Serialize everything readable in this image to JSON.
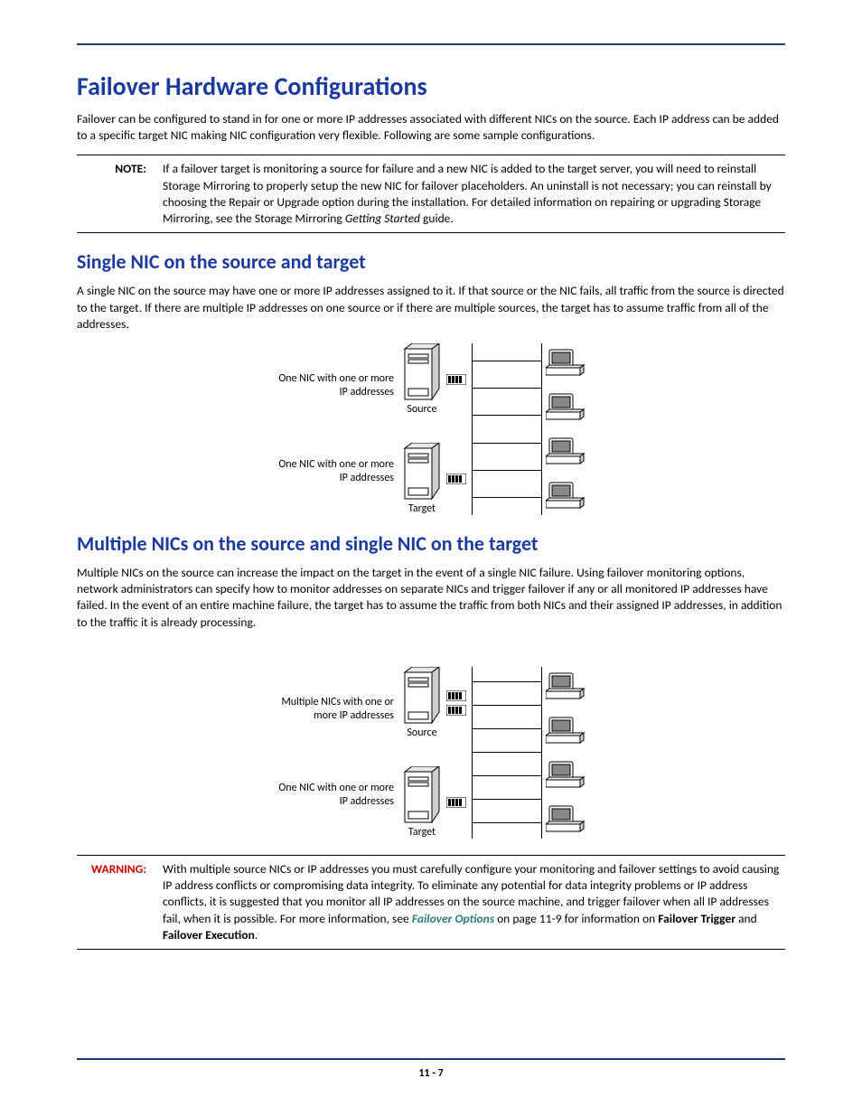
{
  "title": "Failover Hardware Configurations",
  "intro": "Failover can be configured to stand in for one or more IP addresses associated with different NICs on the source. Each IP address can be added to a specific target NIC making NIC configuration very flexible. Following are some sample configurations.",
  "note": {
    "label": "NOTE:",
    "text_a": "If a failover target is monitoring a source for failure and a new NIC is added to the target server, you will need to reinstall Storage Mirroring to properly setup the new NIC for failover placeholders.  An uninstall is not necessary; you can reinstall by choosing the Repair or Upgrade option during the installation. For detailed information on repairing or upgrading Storage Mirroring, see the Storage Mirroring ",
    "ital": "Getting Started",
    "text_b": " guide."
  },
  "section1": {
    "heading": "Single NIC on the source and target",
    "body": "A single NIC on the source may have one or more IP addresses assigned to it. If that source or the NIC fails, all traffic from the source is directed to the target. If there are multiple IP addresses on one source or if there are multiple sources, the target has to assume traffic from all of the addresses.",
    "label_source": "One NIC with one or more IP addresses",
    "label_target": "One NIC with one or more IP addresses",
    "caption_source": "Source",
    "caption_target": "Target"
  },
  "section2": {
    "heading": "Multiple NICs on the source and single NIC on the target",
    "body": "Multiple NICs on the source can increase the impact on the target in the event of a single NIC failure. Using failover monitoring options, network administrators can specify how to monitor addresses on separate NICs and trigger failover if any or all monitored IP addresses have failed. In the event of an entire machine failure, the target has to assume the traffic from both NICs and their assigned IP addresses, in addition to the traffic it is already processing.",
    "label_source": "Multiple NICs with one or more IP addresses",
    "label_target": "One NIC with one or more IP addresses",
    "caption_source": "Source",
    "caption_target": "Target"
  },
  "warning": {
    "label": "WARNING:",
    "text_a": "With multiple source NICs or IP addresses you must carefully configure your monitoring and failover settings to avoid causing IP address conflicts or compromising data integrity. To eliminate any potential for data integrity problems or IP address conflicts, it is suggested that you monitor all IP addresses on the source machine, and trigger failover when all IP addresses fail, when it is possible.  For more information, see ",
    "link": "Failover Options",
    "text_b": " on page 11-9 for information on ",
    "bold1": "Failover Trigger",
    "text_c": " and ",
    "bold2": "Failover Execution",
    "text_d": "."
  },
  "page_number": "11 - 7"
}
